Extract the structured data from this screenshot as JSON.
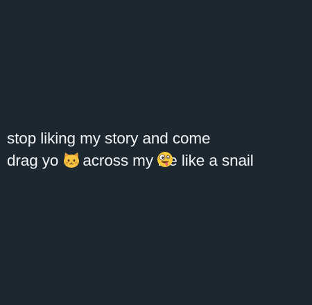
{
  "post": {
    "line1": "stop liking my story and come",
    "line2_part1": "drag yo",
    "line2_emoji1": "cat-face-icon",
    "line2_part2": "across my f",
    "line2_emoji2": "zany-face-icon",
    "line2_part3": "e like a snail"
  },
  "colors": {
    "background": "#1c2730",
    "text": "#f3f5f7"
  }
}
